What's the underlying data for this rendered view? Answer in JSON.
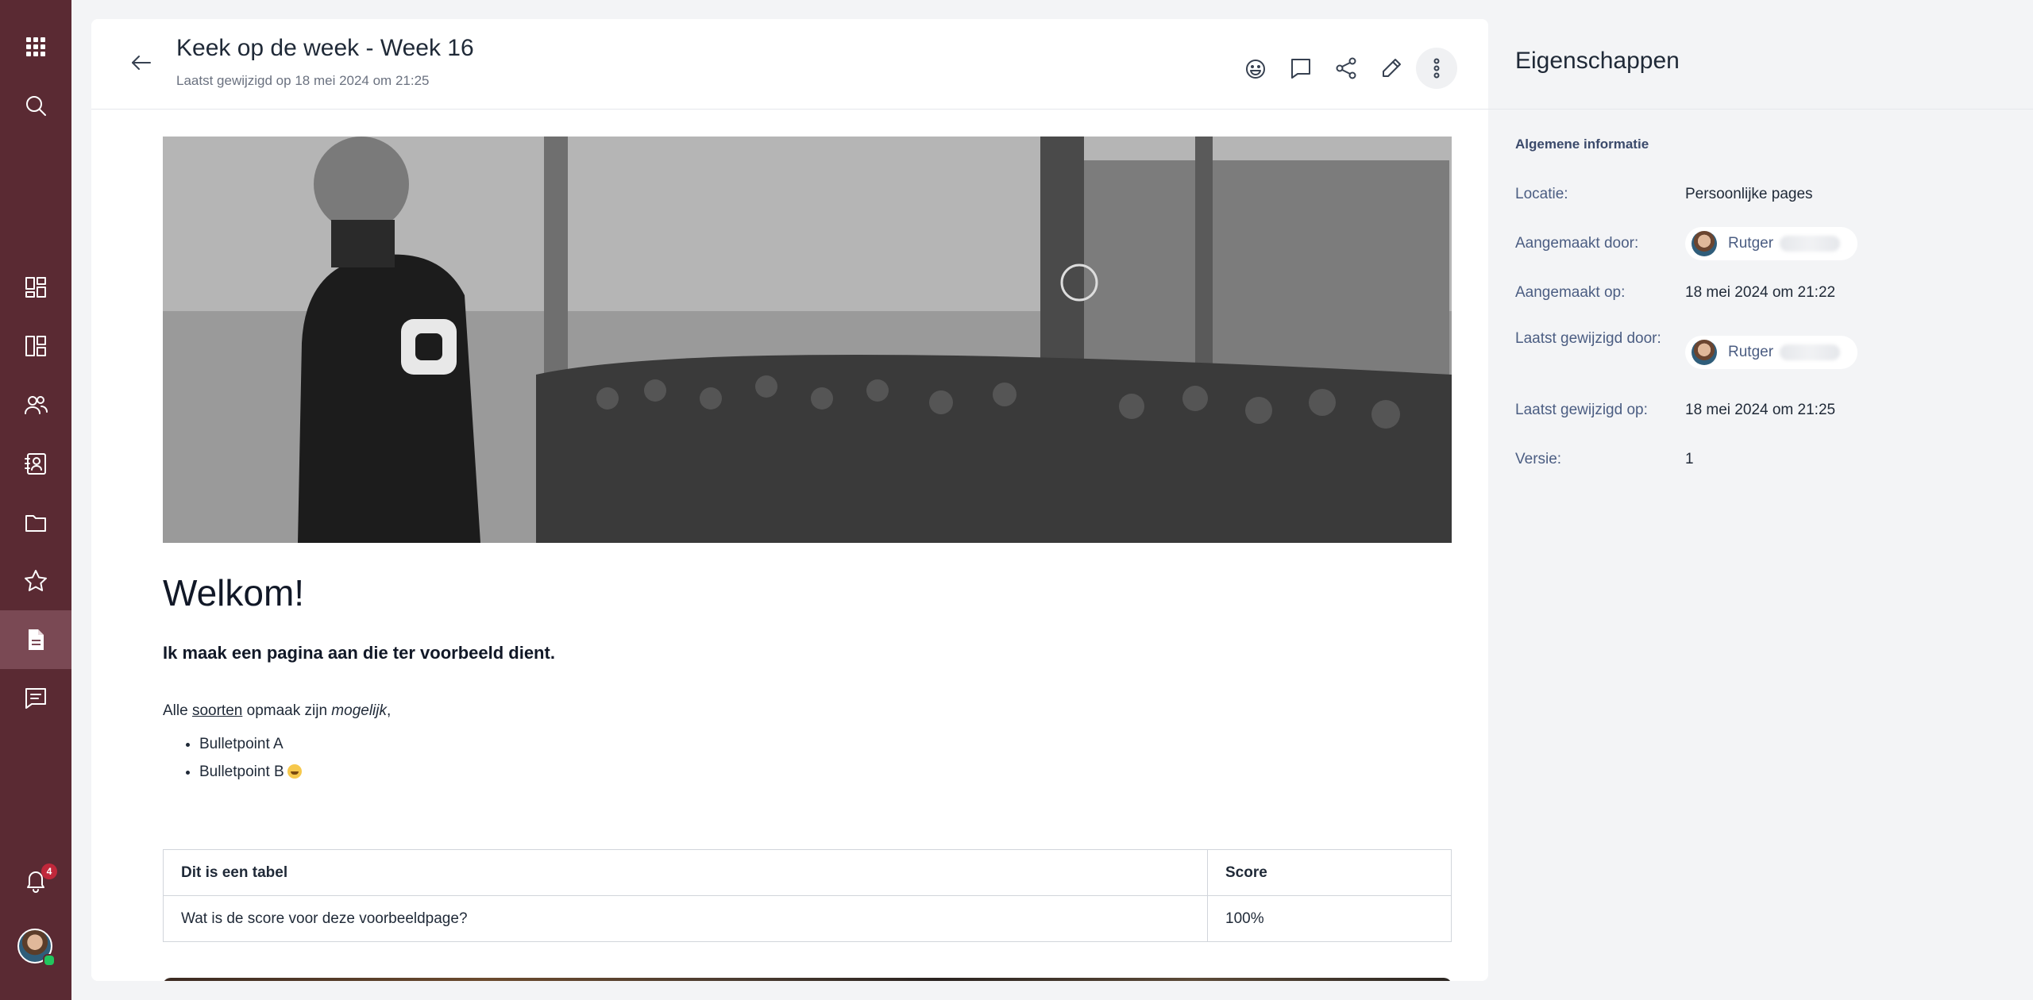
{
  "nav": {
    "items": [
      {
        "name": "apps-grid-icon"
      },
      {
        "name": "search-icon"
      },
      {
        "name": "dashboard-icon"
      },
      {
        "name": "widgets-icon"
      },
      {
        "name": "people-icon"
      },
      {
        "name": "contacts-icon"
      },
      {
        "name": "folder-icon"
      },
      {
        "name": "star-icon"
      },
      {
        "name": "pages-icon",
        "active": true
      },
      {
        "name": "chat-icon"
      }
    ],
    "notifications_count": "4",
    "colors": {
      "rail": "#5a2a33",
      "active": "#7a4954",
      "badge": "#c0283b"
    }
  },
  "header": {
    "title": "Keek op de week - Week 16",
    "subtitle": "Laatst gewijzigd op 18 mei 2024 om 21:25",
    "tools": [
      "emoji-reaction-icon",
      "comment-icon",
      "share-icon",
      "edit-icon",
      "more-vertical-icon"
    ]
  },
  "article": {
    "heading": "Welkom!",
    "lead": "Ik maak een pagina aan die ter voorbeeld dient.",
    "para_prefix": "Alle ",
    "para_link": "soorten",
    "para_middle": " opmaak zijn ",
    "para_italic": "mogelijk",
    "para_suffix": ",",
    "bullets": [
      "Bulletpoint A",
      "Bulletpoint B"
    ],
    "table": {
      "headers": [
        "Dit is een tabel",
        "Score"
      ],
      "rows": [
        [
          "Wat is de score voor deze voorbeeldpage?",
          "100%"
        ]
      ]
    }
  },
  "properties": {
    "title": "Eigenschappen",
    "section": "Algemene informatie",
    "rows": [
      {
        "label": "Locatie:",
        "value": "Persoonlijke pages"
      },
      {
        "label": "Aangemaakt door:",
        "value": "Rutger"
      },
      {
        "label": "Aangemaakt op:",
        "value": "18 mei 2024 om 21:22"
      },
      {
        "label": "Laatst gewijzigd door:",
        "value": "Rutger"
      },
      {
        "label": "Laatst gewijzigd op:",
        "value": "18 mei 2024 om 21:25"
      },
      {
        "label": "Versie:",
        "value": "1"
      }
    ]
  }
}
